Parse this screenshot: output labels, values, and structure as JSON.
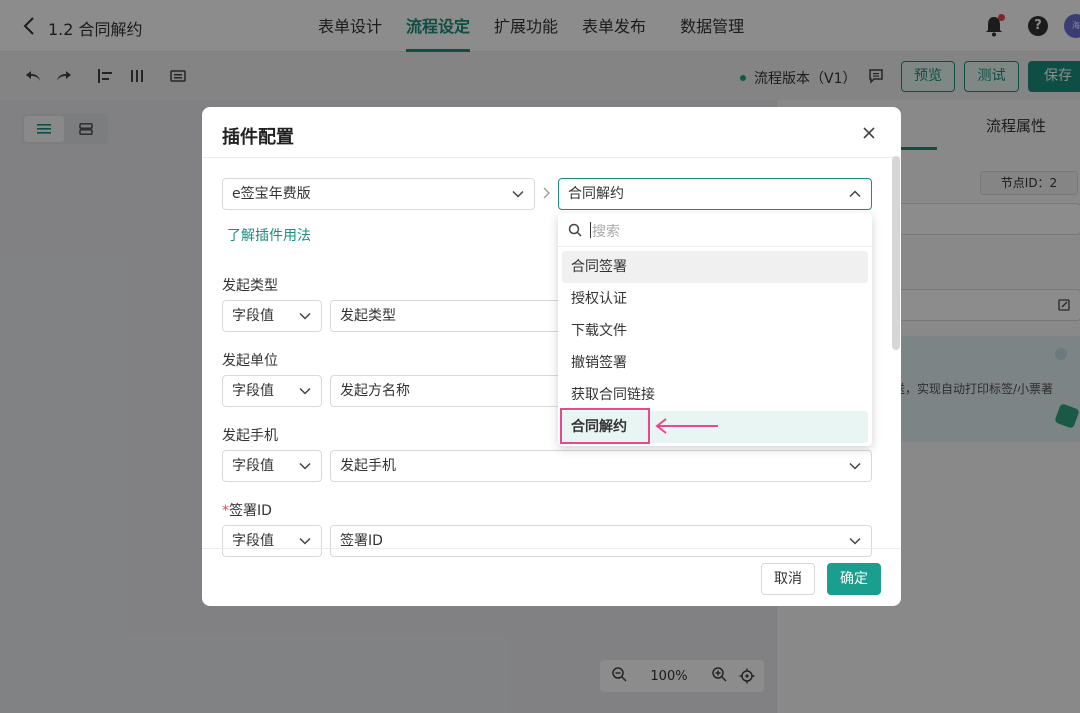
{
  "app": {
    "title": "1.2 合同解约"
  },
  "nav": {
    "tabs": [
      "表单设计",
      "流程设定",
      "扩展功能",
      "表单发布",
      "数据管理"
    ],
    "active_index": 1
  },
  "avatar_text": "海",
  "toolbar": {
    "version": "流程版本（V1）",
    "preview": "预览",
    "test": "测试",
    "save": "保存"
  },
  "canvas": {
    "zoom": "100%"
  },
  "right_panel": {
    "tab": "流程属性",
    "node_id": "节点ID：2",
    "promo_text": "送，实现自动打印标签/小票著"
  },
  "modal": {
    "title": "插件配置",
    "plugin_select": "e签宝年费版",
    "action_select": "合同解约",
    "learn_link": "了解插件用法",
    "fields": [
      {
        "label": "发起类型",
        "required": false,
        "mode": "字段值",
        "value": "发起类型"
      },
      {
        "label": "发起单位",
        "required": false,
        "mode": "字段值",
        "value": "发起方名称"
      },
      {
        "label": "发起手机",
        "required": false,
        "mode": "字段值",
        "value": "发起手机"
      },
      {
        "label": "签署ID",
        "required": true,
        "mode": "字段值",
        "value": "签署ID"
      }
    ],
    "cancel": "取消",
    "ok": "确定"
  },
  "dropdown": {
    "placeholder": "搜索",
    "options": [
      "合同签署",
      "授权认证",
      "下载文件",
      "撤销签署",
      "获取合同链接",
      "合同解约"
    ],
    "hover_index": 0,
    "selected_index": 5
  },
  "colors": {
    "accent": "#1a8e7d",
    "highlight": "#e8498c",
    "required": "#e84545"
  }
}
